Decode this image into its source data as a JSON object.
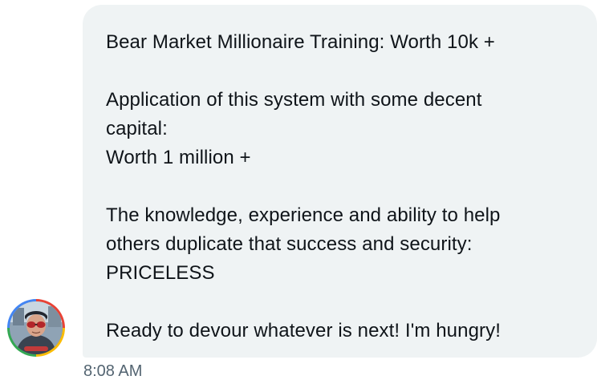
{
  "message": {
    "paragraphs": [
      "Bear Market Millionaire Training: Worth 10k +",
      "Application of this system with some decent\ncapital:\nWorth 1 million +",
      "The knowledge, experience and ability to help\nothers duplicate that success and security:\nPRICELESS",
      "Ready to devour whatever is next! I'm hungry!"
    ],
    "timestamp": "8:08 AM"
  },
  "colors": {
    "bubble_background": "#eff3f4",
    "text": "#0f1419",
    "timestamp": "#536471"
  },
  "icons": {
    "avatar": "user-avatar-photo"
  }
}
